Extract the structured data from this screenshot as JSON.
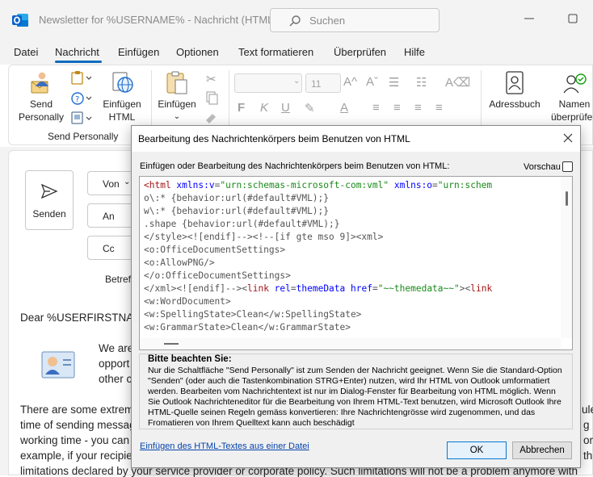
{
  "window": {
    "title": "Newsletter for %USERNAME%  -  Nachricht (HTML)",
    "search_placeholder": "Suchen"
  },
  "menu": [
    "Datei",
    "Nachricht",
    "Einfügen",
    "Optionen",
    "Text formatieren",
    "Überprüfen",
    "Hilfe"
  ],
  "ribbon": {
    "send_personally": [
      "Send",
      "Personally"
    ],
    "insert_html": [
      "Einfügen",
      "HTML"
    ],
    "paste": "Einfügen",
    "group_label": "Send Personally",
    "font_size": "11",
    "address_book": "Adressbuch",
    "check_names": [
      "Namen",
      "überprüfen"
    ]
  },
  "compose": {
    "send": "Senden",
    "from": "Von",
    "to": "An",
    "cc": "Cc",
    "subject_label": "Betreff",
    "greeting": "Dear %USERFIRSTNAME",
    "para1": [
      "We are",
      "opport",
      "other c"
    ],
    "para2": [
      "There are some extrem",
      "time of sending messag",
      "working time - you can",
      "example, if your recipie",
      "limitations declared by your service provider or corporate policy. Such limitations will not be a problem anymore with"
    ],
    "para2_right": [
      "ule",
      "g",
      "or",
      "th"
    ]
  },
  "dialog": {
    "title": "Bearbeitung des Nachrichtenkörpers beim Benutzen von HTML",
    "prompt": "Einfügen oder Bearbeitung des Nachrichtenkörpers beim Benutzen von HTML:",
    "preview": "Vorschau",
    "code_lines": [
      [
        [
          "tag",
          "<html "
        ],
        [
          "attr",
          "xmlns:v"
        ],
        [
          "plain",
          "="
        ],
        [
          "val",
          "\"urn:schemas-microsoft-com:vml\""
        ],
        [
          "plain",
          " "
        ],
        [
          "attr",
          "xmlns:o"
        ],
        [
          "plain",
          "="
        ],
        [
          "val",
          "\"urn:schem"
        ]
      ],
      [
        [
          "plain",
          "o\\:* {behavior:url(#default#VML);}"
        ]
      ],
      [
        [
          "plain",
          "w\\:* {behavior:url(#default#VML);}"
        ]
      ],
      [
        [
          "plain",
          ".shape {behavior:url(#default#VML);}"
        ]
      ],
      [
        [
          "plain",
          "</style><![endif]--><!--[if gte mso 9]><xml>"
        ]
      ],
      [
        [
          "plain",
          "<o:OfficeDocumentSettings>"
        ]
      ],
      [
        [
          "plain",
          "<o:AllowPNG/>"
        ]
      ],
      [
        [
          "plain",
          "</o:OfficeDocumentSettings>"
        ]
      ],
      [
        [
          "plain",
          "</xml><![endif]--><"
        ],
        [
          "tag",
          "link "
        ],
        [
          "attr",
          "rel"
        ],
        [
          "plain",
          "="
        ],
        [
          "attr",
          "themeData "
        ],
        [
          "attr",
          "href"
        ],
        [
          "plain",
          "="
        ],
        [
          "val",
          "\"~~themedata~~\""
        ],
        [
          "plain",
          "><"
        ],
        [
          "tag",
          "link"
        ]
      ],
      [
        [
          "plain",
          "<w:WordDocument>"
        ]
      ],
      [
        [
          "plain",
          "<w:SpellingState>Clean</w:SpellingState>"
        ]
      ],
      [
        [
          "plain",
          "<w:GrammarState>Clean</w:GrammarState>"
        ]
      ]
    ],
    "note_title": "Bitte beachten Sie:",
    "note_text": "Nur die Schaltfläche \"Send Personally\" ist zum Senden der Nachricht geeignet. Wenn Sie die Standard-Option \"Senden\" (oder auch die Tastenkombination STRG+Enter) nutzen, wird Ihr HTML von Outlook umformatiert werden. Bearbeiten vom Nachrichtentext ist nur im Dialog-Fenster für Bearbeitung von HTML möglich. Wenn Sie Outlook Nachrichteneditor für die Bearbeitung von Ihrem HTML-Text benutzen, wird Microsoft Outlook Ihre HTML-Quelle seinen Regeln gemäss konvertieren: Ihre Nachrichtengrösse wird zugenommen, und das Fromatieren von Ihrem Quelltext kann auch beschädigt",
    "link": "Einfügen des HTML-Textes aus einer Datei",
    "ok": "OK",
    "cancel": "Abbrechen"
  },
  "colors": {
    "accent": "#0f6cbd",
    "outlook_blue": "#0a64c8",
    "code_tag": "#a31515",
    "code_attr": "#0000ff",
    "code_value": "#1a8a1a"
  },
  "icons": [
    "outlook-app-icon",
    "search-icon",
    "close-icon",
    "maximize-icon",
    "send-personally-icon",
    "paste-icon",
    "insert-html-icon",
    "address-book-icon",
    "check-names-icon",
    "send-icon",
    "contact-card-icon"
  ]
}
